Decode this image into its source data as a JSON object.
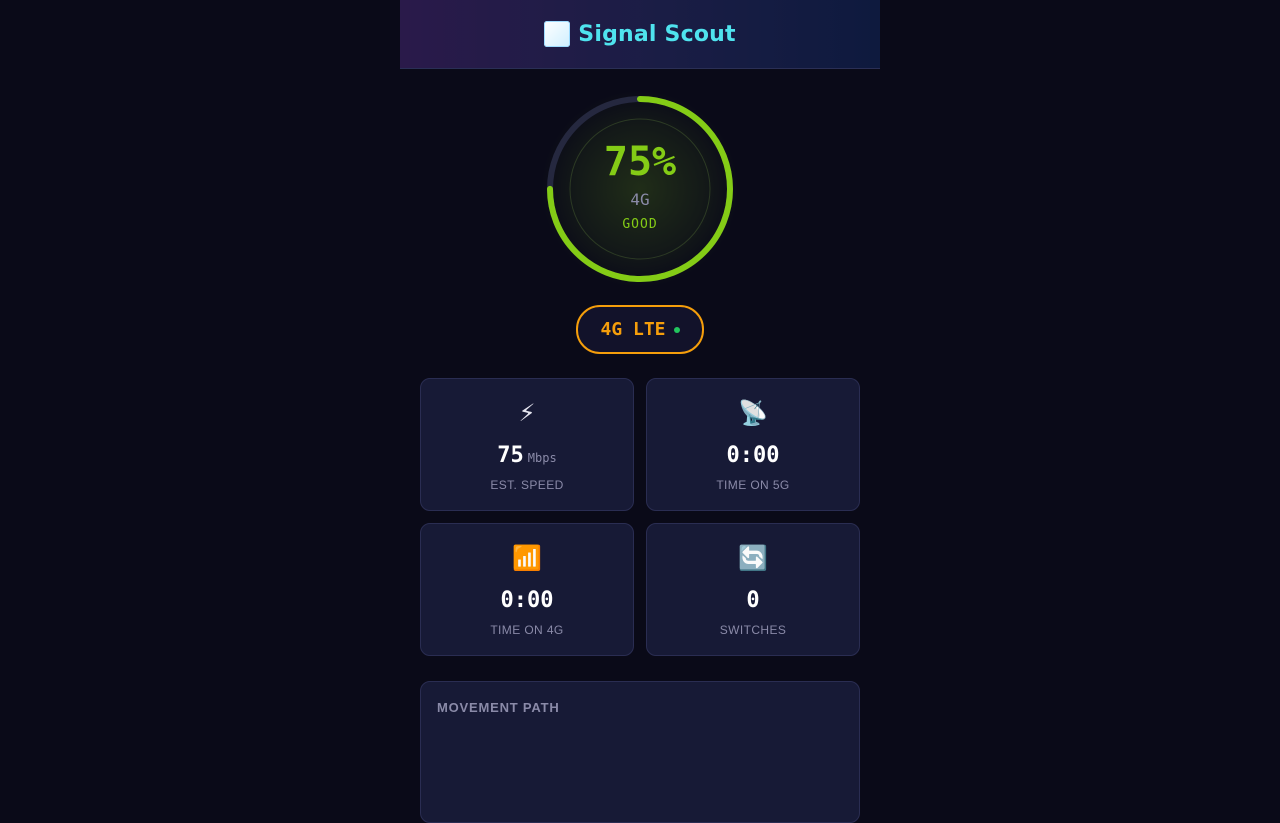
{
  "header": {
    "title_part1": "Signal",
    "title_part2": "Scout",
    "logo_icon": "app-logo-icon"
  },
  "gauge": {
    "percent_text": "75%",
    "percent_value": 75,
    "network": "4G",
    "quality": "GOOD",
    "accent_color": "#84cc16",
    "track_color": "#25283f"
  },
  "network_badge": {
    "label": "4G LTE",
    "color": "#f59e0b",
    "status_dot_color": "#22c55e"
  },
  "stats": [
    {
      "icon": "lightning-icon",
      "glyph": "⚡",
      "value": "75",
      "unit": "Mbps",
      "label": "EST. SPEED"
    },
    {
      "icon": "satellite-dish-icon",
      "glyph": "📡",
      "value": "0:00",
      "unit": "",
      "label": "TIME ON 5G"
    },
    {
      "icon": "signal-bars-icon",
      "glyph": "📶",
      "value": "0:00",
      "unit": "",
      "label": "TIME ON 4G"
    },
    {
      "icon": "refresh-icon",
      "glyph": "🔄",
      "value": "0",
      "unit": "",
      "label": "SWITCHES"
    }
  ],
  "movement_path": {
    "title": "MOVEMENT PATH"
  }
}
